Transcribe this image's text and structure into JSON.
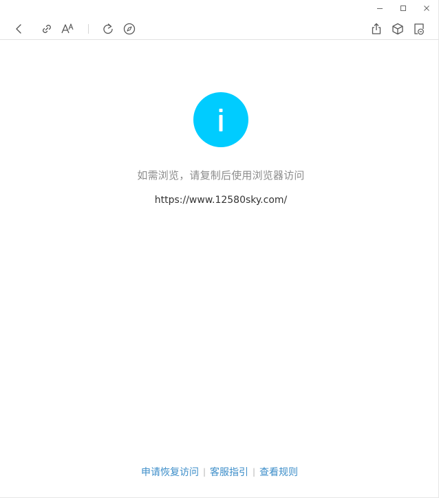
{
  "window_controls": {
    "minimize_icon": "minimize-icon",
    "maximize_icon": "maximize-icon",
    "close_icon": "close-icon"
  },
  "toolbar": {
    "left_icons": [
      "back-icon",
      "link-icon",
      "font-size-icon",
      "refresh-icon",
      "compass-icon"
    ],
    "right_icons": [
      "share-icon",
      "cube-icon",
      "mini-program-icon"
    ]
  },
  "notice": {
    "icon": "info-icon",
    "message": "如需浏览，请复制后使用浏览器访问",
    "url": "https://www.12580sky.com/"
  },
  "footer": {
    "links": [
      "申请恢复访问",
      "客服指引",
      "查看规则"
    ],
    "separator": "|"
  },
  "colors": {
    "accent": "#00ccff",
    "link": "#3d8ec9",
    "message_text": "#8c8c8c",
    "url_text": "#333333",
    "icon_stroke": "#555555"
  }
}
